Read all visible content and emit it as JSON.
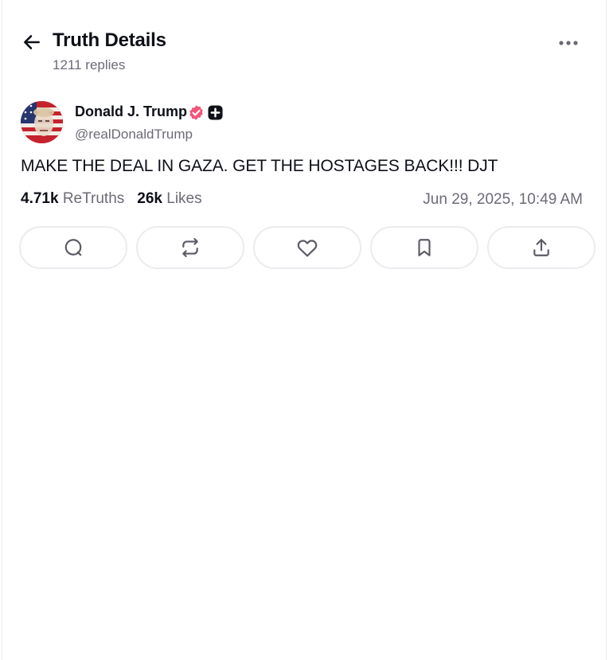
{
  "header": {
    "title": "Truth Details",
    "replies": "1211 replies"
  },
  "post": {
    "author_name": "Donald J. Trump",
    "handle": "@realDonaldTrump",
    "text": "MAKE THE DEAL IN GAZA. GET THE HOSTAGES BACK!!! DJT",
    "retruths_count": "4.71k",
    "retruths_label": "ReTruths",
    "likes_count": "26k",
    "likes_label": "Likes",
    "timestamp": "Jun 29, 2025, 10:49 AM"
  },
  "actions": [
    {
      "icon": "reply-icon"
    },
    {
      "icon": "retruth-icon"
    },
    {
      "icon": "like-icon"
    },
    {
      "icon": "bookmark-icon"
    },
    {
      "icon": "share-icon"
    }
  ],
  "colors": {
    "verified": "#f2557a",
    "text_primary": "#0e1017",
    "text_secondary": "#6b6b76",
    "border": "#ececf0"
  }
}
